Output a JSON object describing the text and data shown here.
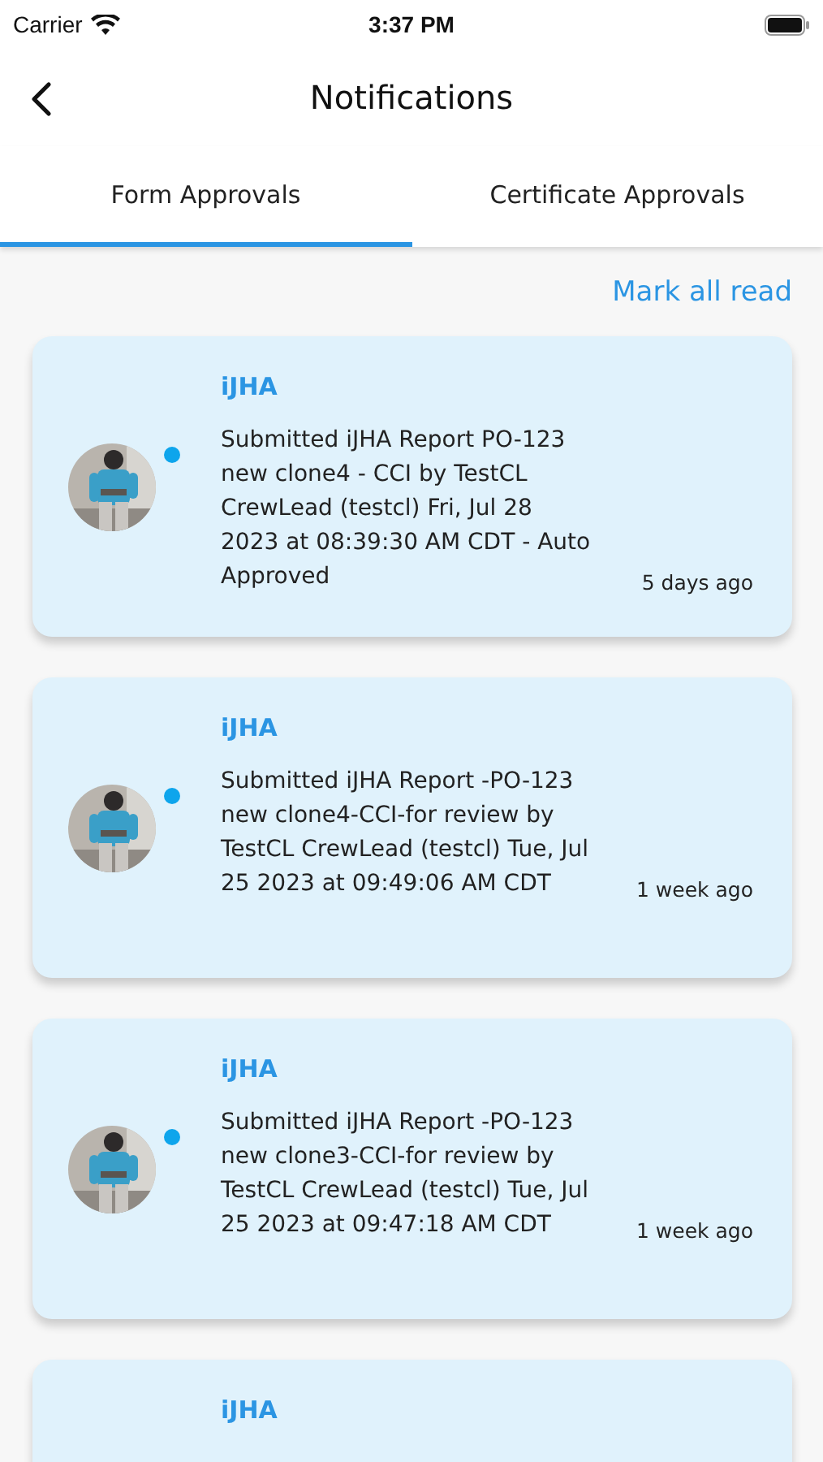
{
  "status_bar": {
    "carrier": "Carrier",
    "time": "3:37 PM"
  },
  "header": {
    "title": "Notifications"
  },
  "tabs": [
    {
      "label": "Form Approvals",
      "selected": true
    },
    {
      "label": "Certificate Approvals",
      "selected": false
    }
  ],
  "mark_all_read": "Mark all read",
  "notifications": [
    {
      "title": "iJHA",
      "message": "Submitted iJHA Report PO-123 new clone4 - CCI by  TestCL CrewLead (testcl) Fri, Jul 28 2023 at 08:39:30 AM CDT - Auto Approved",
      "time": "5 days ago",
      "unread": true
    },
    {
      "title": "iJHA",
      "message": "Submitted iJHA Report -PO-123 new clone4-CCI-for review by TestCL CrewLead (testcl) Tue, Jul 25 2023 at 09:49:06 AM CDT",
      "time": "1 week ago",
      "unread": true
    },
    {
      "title": "iJHA",
      "message": "Submitted iJHA Report -PO-123 new clone3-CCI-for review by TestCL CrewLead (testcl) Tue, Jul 25 2023 at 09:47:18 AM CDT",
      "time": "1 week ago",
      "unread": true
    },
    {
      "title": "iJHA"
    }
  ]
}
